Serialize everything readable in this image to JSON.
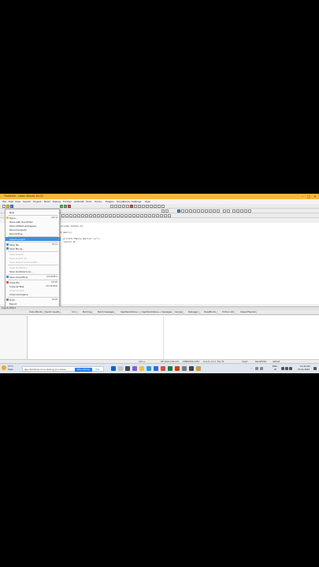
{
  "window": {
    "title": "*Untitled - Code::Blocks 20.03"
  },
  "menubar": [
    "File",
    "Edit",
    "View",
    "Search",
    "Project",
    "Build",
    "Debug",
    "Fortran",
    "wxSmith",
    "Tools",
    "Tools+",
    "Plugins",
    "DoxyBlocks",
    "Settings",
    "Help"
  ],
  "file_menu": {
    "items": [
      {
        "label": "New",
        "shortcut": "",
        "arrow": true,
        "disabled": false,
        "highlight": false
      },
      {
        "label": "Open...",
        "shortcut": "Ctrl-O",
        "arrow": false,
        "disabled": false,
        "highlight": false
      },
      {
        "label": "Open with Hex Editor",
        "shortcut": "",
        "arrow": false,
        "disabled": false,
        "highlight": false
      },
      {
        "label": "Open default workspace",
        "shortcut": "",
        "arrow": false,
        "disabled": false,
        "highlight": false
      },
      {
        "label": "Recent projects",
        "shortcut": "",
        "arrow": true,
        "disabled": false,
        "highlight": false
      },
      {
        "label": "Recent files",
        "shortcut": "",
        "arrow": true,
        "disabled": false,
        "highlight": false
      },
      {
        "label": "Import project",
        "shortcut": "",
        "arrow": true,
        "disabled": false,
        "highlight": true
      },
      {
        "label": "Save file",
        "shortcut": "Ctrl-S",
        "arrow": false,
        "disabled": false,
        "highlight": false
      },
      {
        "label": "Save file as...",
        "shortcut": "",
        "arrow": false,
        "disabled": false,
        "highlight": false
      },
      {
        "label": "Save project",
        "shortcut": "",
        "arrow": false,
        "disabled": true,
        "highlight": false
      },
      {
        "label": "Save project as...",
        "shortcut": "",
        "arrow": false,
        "disabled": true,
        "highlight": false
      },
      {
        "label": "Save project as template...",
        "shortcut": "",
        "arrow": false,
        "disabled": true,
        "highlight": false
      },
      {
        "label": "Save workspace",
        "shortcut": "",
        "arrow": false,
        "disabled": true,
        "highlight": false
      },
      {
        "label": "Save workspace as...",
        "shortcut": "",
        "arrow": false,
        "disabled": false,
        "highlight": false
      },
      {
        "label": "Save everything",
        "shortcut": "Ctrl-Shift-S",
        "arrow": false,
        "disabled": false,
        "highlight": false
      },
      {
        "label": "Close file",
        "shortcut": "Ctrl-W",
        "arrow": false,
        "disabled": false,
        "highlight": false
      },
      {
        "label": "Close all files",
        "shortcut": "Ctrl-Shift-W",
        "arrow": false,
        "disabled": false,
        "highlight": false
      },
      {
        "label": "Close project",
        "shortcut": "",
        "arrow": false,
        "disabled": true,
        "highlight": false
      },
      {
        "label": "Close workspace",
        "shortcut": "",
        "arrow": false,
        "disabled": false,
        "highlight": false
      },
      {
        "label": "Print...",
        "shortcut": "Ctrl-P",
        "arrow": false,
        "disabled": false,
        "highlight": false
      },
      {
        "label": "Export",
        "shortcut": "",
        "arrow": true,
        "disabled": false,
        "highlight": false
      },
      {
        "label": "Properties...",
        "shortcut": "",
        "arrow": false,
        "disabled": false,
        "highlight": false
      },
      {
        "label": "Quit",
        "shortcut": "Ctrl-Q",
        "arrow": false,
        "disabled": false,
        "highlight": false
      }
    ]
  },
  "editor": {
    "lines": [
      "#include <stdio.h>",
      "",
      "int main()",
      "{",
      "    printf(\"Hello World! \\n\");",
      "    return 0;",
      "}"
    ]
  },
  "logs": {
    "header": "Logs & others",
    "tabs": [
      "Code::Blocks",
      "Search results",
      "Cccc",
      "Build log",
      "Build messages",
      "CppCheck/Vera++",
      "CppCheck/Vera++ messages",
      "Cscope",
      "Debugger",
      "DoxyBlocks",
      "Fortran info",
      "Closed files list"
    ]
  },
  "status": {
    "file": "C/C++",
    "eol": "Windows (CR+LF)",
    "encoding": "WINDOWS-1252",
    "position": "Line 6, Col 1, Pos 79",
    "mode": "Insert",
    "rw": "Read/Write",
    "profile": "default"
  },
  "taskbar": {
    "weather_temp": "27°C",
    "weather_desc": "Haze",
    "notification": "app.clipchamp.com is sharing your screen.",
    "stop_sharing": "Stop sharing",
    "hide": "Hide",
    "lang": "ENG",
    "region": "IN",
    "time": "11:42 AM",
    "date": "07-01-2023"
  },
  "colors": {
    "titlebar": "#f6b93b",
    "highlight": "#3d8ee0"
  }
}
